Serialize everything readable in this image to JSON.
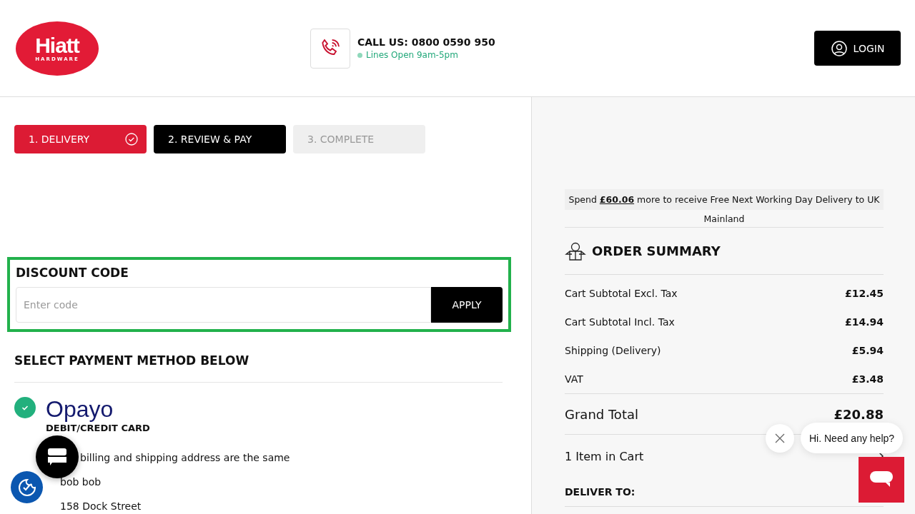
{
  "header": {
    "logo": {
      "name": "Hiatt",
      "sub": "HARDWARE"
    },
    "call": {
      "label": "CALL US: 0800 0590 950",
      "status": "Lines Open 9am-5pm"
    },
    "login": "LOGIN"
  },
  "steps": [
    {
      "label": "1. DELIVERY",
      "completed": true,
      "selected": false
    },
    {
      "label": "2. REVIEW & PAY",
      "completed": false,
      "selected": true
    },
    {
      "label": "3. COMPLETE",
      "completed": false,
      "selected": false
    }
  ],
  "discount": {
    "title": "DISCOUNT CODE",
    "placeholder": "Enter code",
    "button": "APPLY"
  },
  "payment": {
    "title": "SELECT PAYMENT METHOD BELOW",
    "method": {
      "brand": "Opayo",
      "label": "DEBIT/CREDIT CARD",
      "selected": true
    },
    "same_address": "billing and shipping address are the same",
    "address": [
      "bob bob",
      "158 Dock Street"
    ]
  },
  "summary": {
    "banner": "Spend **£60.06** more to receive Free Next Working Day Delivery to UK",
    "banner_cont": "Mainland",
    "title": "ORDER SUMMARY",
    "rows": [
      {
        "label": "Cart Subtotal Excl. Tax",
        "value": "£12.45"
      },
      {
        "label": "Cart Subtotal Incl. Tax",
        "value": "£14.94"
      },
      {
        "label": "Shipping (Delivery)",
        "value": "£5.94"
      },
      {
        "label": "VAT",
        "value": "£3.48"
      }
    ],
    "total": {
      "label": "Grand Total",
      "value": "£20.88"
    },
    "cart": "1 Item in Cart",
    "deliver_to": "DELIVER TO:"
  },
  "chat": {
    "greeting": "Hi. Need any help?"
  }
}
